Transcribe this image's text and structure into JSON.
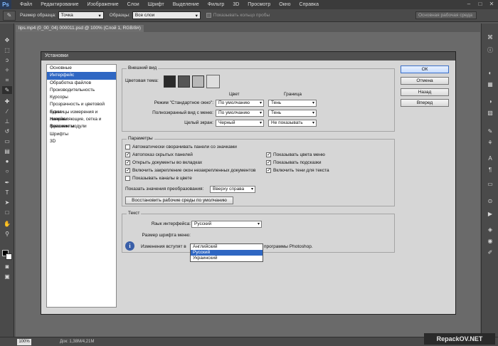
{
  "app": {
    "logo": "Ps",
    "menu": [
      "Файл",
      "Редактирование",
      "Изображение",
      "Слои",
      "Шрифт",
      "Выделение",
      "Фильтр",
      "3D",
      "Просмотр",
      "Окно",
      "Справка"
    ],
    "window_controls": [
      "–",
      "□",
      "✕"
    ]
  },
  "options_bar": {
    "tool_icon": "eyedropper-icon",
    "sample_size_label": "Размер образца:",
    "sample_size_value": "Точка",
    "sample_label": "Образцы:",
    "sample_value": "Все слои",
    "show_ring_label": "Показывать кольцо пробы",
    "workspace_label": "Основная рабочая среда"
  },
  "document": {
    "tab_title": "lips.mp4 (0_00_04) 000011.psd @ 100% (Слой 1, RGB/8#)",
    "zoom": "100%",
    "doc_info": "Док: 1,38M/4,21M"
  },
  "watermark": "RepackOV.NET",
  "dialog": {
    "title": "Установки",
    "nav": [
      "Основные",
      "Интерфейс",
      "Обработка файлов",
      "Производительность",
      "Курсоры",
      "Прозрачность и цветовой охват",
      "Единицы измерения и линейки",
      "Направляющие, сетка и фрагменты",
      "Внешние модули",
      "Шрифты",
      "3D"
    ],
    "nav_selected": 1,
    "buttons": {
      "ok": "ОК",
      "cancel": "Отмена",
      "prev": "Назад",
      "next": "Вперед"
    },
    "appearance": {
      "title": "Внешний вид",
      "theme_label": "Цветовая тема:",
      "theme_swatches": [
        "#2b2b2b",
        "#555555",
        "#b8b8b8",
        "#dedede"
      ],
      "col_color": "Цвет",
      "col_border": "Граница",
      "rows": [
        {
          "label": "Режим \"Стандартное окно\":",
          "color": "По умолчанию",
          "border": "Тень"
        },
        {
          "label": "Полноэкранный вид с меню:",
          "color": "По умолчанию",
          "border": "Тень"
        },
        {
          "label": "Целый экран:",
          "color": "Черный",
          "border": "Не показывать"
        }
      ]
    },
    "params": {
      "title": "Параметры",
      "left": [
        {
          "label": "Автоматически сворачивать панели со значками",
          "checked": false
        },
        {
          "label": "Автопоказ скрытых панелей",
          "checked": true
        },
        {
          "label": "Открыть документы во вкладках",
          "checked": true
        },
        {
          "label": "Включить закрепление окон незакрепленных документов",
          "checked": true
        },
        {
          "label": "Показывать каналы в цвете",
          "checked": false
        }
      ],
      "right": [
        {
          "label": "Показывать цвета меню",
          "checked": true
        },
        {
          "label": "Показывать подсказки",
          "checked": true
        },
        {
          "label": "Включить тени для текста",
          "checked": true
        }
      ],
      "transform_label": "Показать значения преобразования:",
      "transform_value": "Вверху справа",
      "reset_button": "Восстановить рабочие среды по умолчанию"
    },
    "text": {
      "title": "Текст",
      "lang_label": "Язык интерфейса:",
      "lang_value": "Русский",
      "size_label": "Размер шрифта меню:",
      "lang_options": [
        "Английский",
        "Русский",
        "Украинский"
      ],
      "lang_selected": 1,
      "info_prefix": "Изменения вступят в",
      "info_suffix": "программы Photoshop."
    }
  }
}
